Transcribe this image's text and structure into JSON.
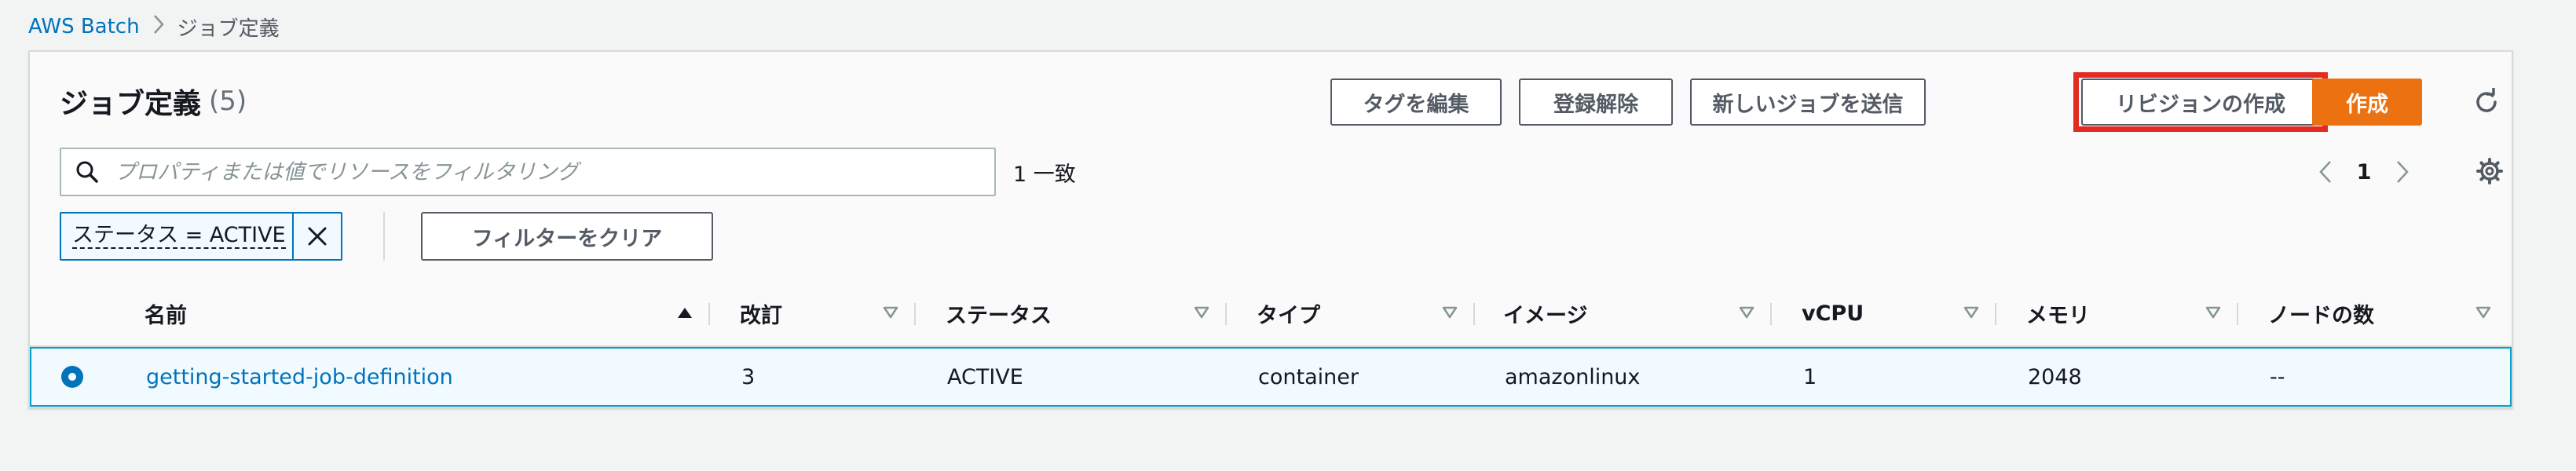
{
  "breadcrumb": {
    "root": "AWS Batch",
    "current": "ジョブ定義"
  },
  "header": {
    "title": "ジョブ定義",
    "count": "(5)"
  },
  "actions": {
    "edit_tags": "タグを編集",
    "deregister": "登録解除",
    "submit_job": "新しいジョブを送信",
    "create_revision": "リビジョンの作成",
    "create": "作成"
  },
  "search": {
    "placeholder": "プロパティまたは値でリソースをフィルタリング",
    "value": "",
    "match_count": "1 一致"
  },
  "pagination": {
    "current_page": "1"
  },
  "filter_token": {
    "label": "ステータス = ACTIVE"
  },
  "clear_filters_label": "フィルターをクリア",
  "table": {
    "columns": [
      "名前",
      "改訂",
      "ステータス",
      "タイプ",
      "イメージ",
      "vCPU",
      "メモリ",
      "ノードの数"
    ],
    "rows": [
      {
        "selected": true,
        "name": "getting-started-job-definition",
        "revision": "3",
        "status": "ACTIVE",
        "type": "container",
        "image": "amazonlinux",
        "vcpu": "1",
        "memory": "2048",
        "nodes": "--"
      }
    ]
  },
  "colors": {
    "primary": "#ec7211",
    "link": "#0073bb",
    "highlight_box": "#e22b22",
    "selected_row_bg": "#f1faff",
    "selected_row_border": "#00a1c9"
  },
  "icons": [
    "chevron-right-icon",
    "refresh-icon",
    "search-icon",
    "chevron-left-icon",
    "settings-gear-icon",
    "close-icon",
    "sort-ascending-icon",
    "sort-caret-icon"
  ]
}
